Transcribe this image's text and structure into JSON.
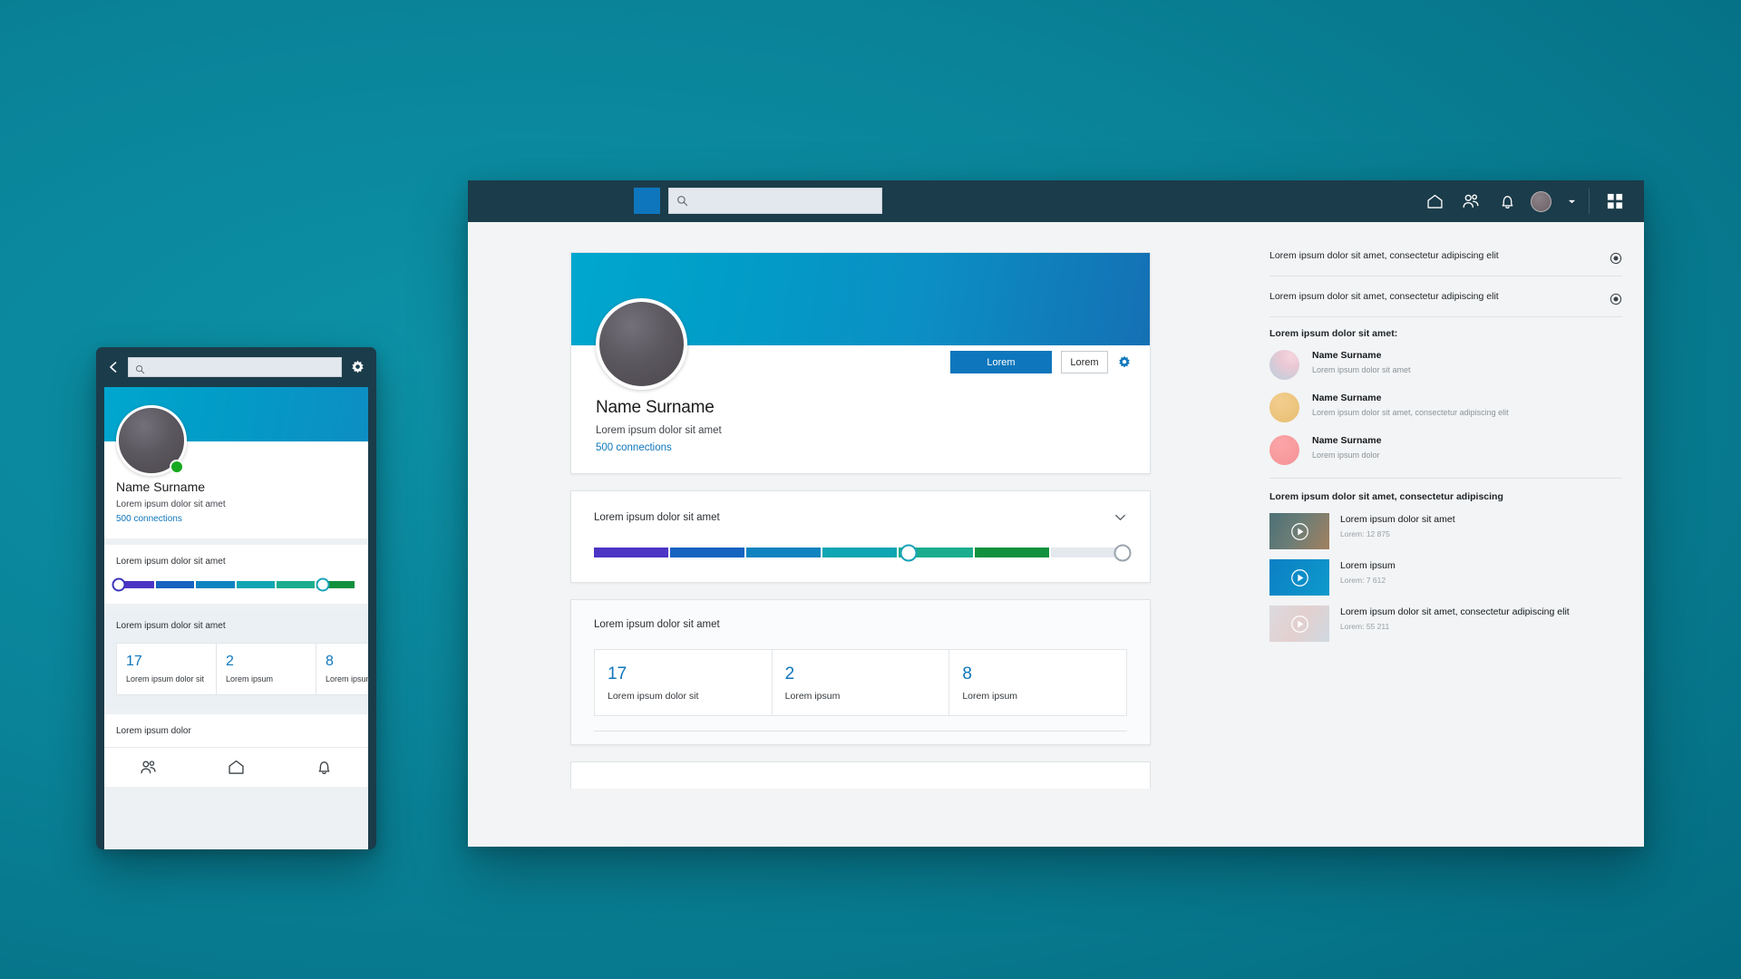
{
  "desktop": {
    "topbar": {
      "logo_name": "app-logo",
      "search_placeholder": "",
      "search_value": "",
      "icons": [
        {
          "name": "home-icon",
          "label": "Home"
        },
        {
          "name": "people-icon",
          "label": "Network"
        },
        {
          "name": "bell-icon",
          "label": "Notifications"
        },
        {
          "name": "avatar-icon",
          "label": "Profile"
        },
        {
          "name": "chevron-down-icon",
          "label": "Account menu"
        },
        {
          "name": "grid-apps-icon",
          "label": "Apps"
        }
      ]
    },
    "profile": {
      "name": "Name Surname",
      "headline": "Lorem ipsum dolor sit amet",
      "connections": "500 connections",
      "primary_button": "Lorem",
      "secondary_button": "Lorem",
      "settings_icon": "gear-icon"
    },
    "slider_card": {
      "title": "Lorem ipsum dolor sit amet",
      "collapse_icon": "chevron-down-icon"
    },
    "stats_card": {
      "title": "Lorem ipsum dolor sit amet",
      "stats": [
        {
          "value": "17",
          "label": "Lorem ipsum dolor sit"
        },
        {
          "value": "2",
          "label": "Lorem ipsum"
        },
        {
          "value": "8",
          "label": "Lorem ipsum"
        }
      ]
    },
    "sidebar": {
      "notifications": [
        {
          "text": "Lorem ipsum dolor sit amet, consectetur adipiscing elit",
          "icon": "radio-target-icon"
        },
        {
          "text": "Lorem ipsum dolor sit amet, consectetur adipiscing elit",
          "icon": "radio-target-icon"
        }
      ],
      "contacts_title": "Lorem ipsum dolor sit amet:",
      "contacts": [
        {
          "name": "Name Surname",
          "sub": "Lorem ipsum dolor sit amet"
        },
        {
          "name": "Name Surname",
          "sub": "Lorem ipsum dolor sit amet, consectetur adipiscing elit"
        },
        {
          "name": "Name Surname",
          "sub": "Lorem ipsum dolor"
        }
      ],
      "media_title": "Lorem ipsum dolor sit amet, consectetur adipiscing",
      "media": [
        {
          "title": "Lorem ipsum dolor sit amet",
          "meta": "Lorem: 12 875",
          "icon": "play-circle-icon"
        },
        {
          "title": "Lorem ipsum",
          "meta": "Lorem: 7 612",
          "icon": "play-circle-icon"
        },
        {
          "title": "Lorem ipsum dolor sit amet, consectetur adipiscing elit",
          "meta": "Lorem: 55 211",
          "icon": "play-circle-icon"
        }
      ]
    }
  },
  "mobile": {
    "topbar": {
      "back_icon": "chevron-left-icon",
      "search_placeholder": "",
      "search_value": "",
      "settings_icon": "gear-icon"
    },
    "profile": {
      "name": "Name Surname",
      "headline": "Lorem ipsum dolor sit amet",
      "connections": "500 connections",
      "status": "online"
    },
    "slider_card": {
      "title": "Lorem ipsum dolor sit amet"
    },
    "stats_card": {
      "title": "Lorem ipsum dolor sit amet",
      "stats": [
        {
          "value": "17",
          "label": "Lorem ipsum dolor sit"
        },
        {
          "value": "2",
          "label": "Lorem ipsum"
        },
        {
          "value": "8",
          "label": "Lorem ipsum"
        }
      ]
    },
    "footer_title": "Lorem ipsum dolor",
    "bottom_nav": [
      {
        "name": "people-icon",
        "label": "Network"
      },
      {
        "name": "home-icon",
        "label": "Home"
      },
      {
        "name": "bell-icon",
        "label": "Notifications"
      }
    ]
  },
  "colors": {
    "brand_blue": "#0e76bc",
    "topbar_dark": "#1b3c4a",
    "background_teal": "#0a8499",
    "cover_gradient_start": "#00a7cf",
    "cover_gradient_end": "#1470b4",
    "status_green": "#16a81f",
    "link_blue": "#0e76bc"
  },
  "slider_segments": [
    "#4b35c4",
    "#1663c0",
    "#0f83bf",
    "#10a5b2",
    "#1bad8e",
    "#11913e"
  ]
}
